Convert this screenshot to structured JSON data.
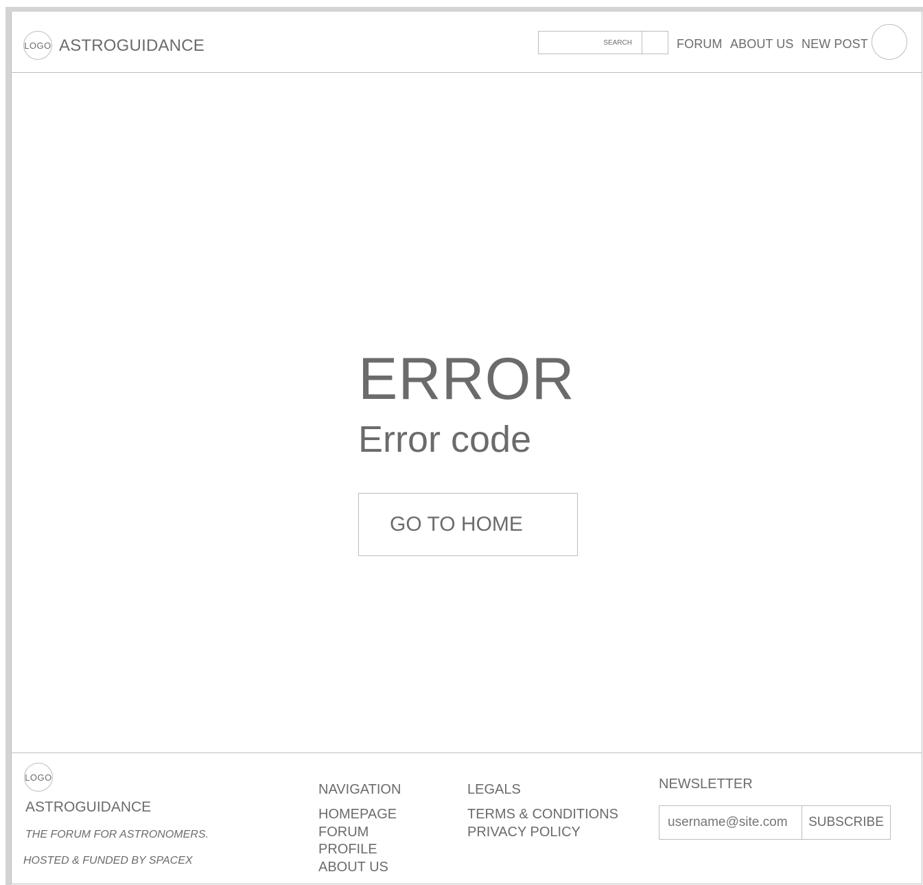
{
  "header": {
    "logo_text": "LOGO",
    "brand": "ASTROGUIDANCE",
    "search": {
      "placeholder": "SEARCH",
      "value": ""
    },
    "nav": [
      {
        "label": "FORUM"
      },
      {
        "label": "ABOUT US"
      },
      {
        "label": "NEW POST"
      }
    ]
  },
  "main": {
    "title": "ERROR",
    "subtitle": "Error code",
    "home_button_label": "GO TO HOME"
  },
  "footer": {
    "logo_text": "LOGO",
    "brand": "ASTROGUIDANCE",
    "tagline": "THE FORUM FOR ASTRONOMERS.",
    "hosted": "HOSTED & FUNDED BY SPACEX",
    "navigation": {
      "heading": "NAVIGATION",
      "items": [
        "HOMEPAGE",
        "FORUM",
        "PROFILE",
        "ABOUT US"
      ]
    },
    "legals": {
      "heading": "LEGALS",
      "items": [
        "TERMS & CONDITIONS",
        "PRIVACY POLICY"
      ]
    },
    "newsletter": {
      "heading": "NEWSLETTER",
      "email_placeholder": "username@site.com",
      "subscribe_label": "SUBSCRIBE"
    }
  },
  "colors": {
    "text": "#6b6b6b",
    "border": "#bdbdbd",
    "frame": "#d4d4d4",
    "background": "#ffffff"
  }
}
